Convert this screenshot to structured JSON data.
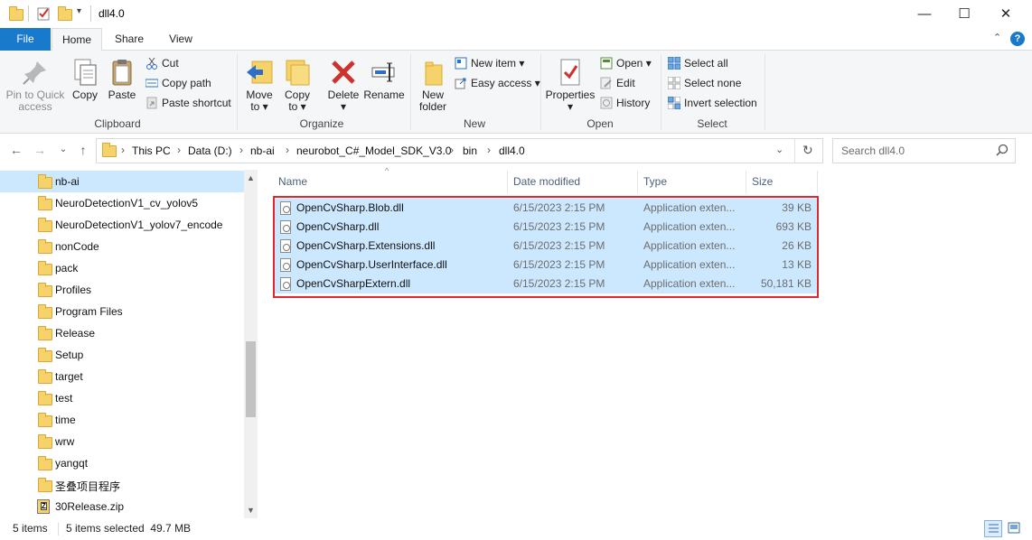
{
  "title": "dll4.0",
  "window_buttons": {
    "minimize": "—",
    "maximize": "☐",
    "close": "✕"
  },
  "tabs": {
    "file": "File",
    "home": "Home",
    "share": "Share",
    "view": "View"
  },
  "ribbon": {
    "clipboard": {
      "label": "Clipboard",
      "pin": "Pin to Quick access",
      "pin_line1": "Pin to Quick",
      "pin_line2": "access",
      "copy": "Copy",
      "paste": "Paste",
      "cut": "Cut",
      "copy_path": "Copy path",
      "paste_shortcut": "Paste shortcut"
    },
    "organize": {
      "label": "Organize",
      "move_to_1": "Move",
      "move_to_2": "to ▾",
      "copy_to_1": "Copy",
      "copy_to_2": "to ▾",
      "delete_1": "Delete",
      "delete_2": "▾",
      "rename": "Rename"
    },
    "new": {
      "label": "New",
      "new_folder_1": "New",
      "new_folder_2": "folder",
      "new_item": "New item ▾",
      "easy_access": "Easy access ▾"
    },
    "open": {
      "label": "Open",
      "properties": "Properties",
      "properties_arrow": "▾",
      "open": "Open ▾",
      "edit": "Edit",
      "history": "History"
    },
    "select": {
      "label": "Select",
      "select_all": "Select all",
      "select_none": "Select none",
      "invert": "Invert selection"
    }
  },
  "address": {
    "crumbs": [
      "This PC",
      "Data (D:)",
      "nb-ai",
      "neurobot_C#_Model_SDK_V3.0",
      "bin",
      "dll4.0"
    ],
    "search_placeholder": "Search dll4.0"
  },
  "nav": {
    "items": [
      {
        "label": "nb-ai",
        "selected": true
      },
      {
        "label": "NeuroDetectionV1_cv_yolov5"
      },
      {
        "label": "NeuroDetectionV1_yolov7_encode"
      },
      {
        "label": "nonCode"
      },
      {
        "label": "pack"
      },
      {
        "label": "Profiles"
      },
      {
        "label": "Program Files"
      },
      {
        "label": "Release"
      },
      {
        "label": "Setup"
      },
      {
        "label": "target"
      },
      {
        "label": "test"
      },
      {
        "label": "time"
      },
      {
        "label": "wrw"
      },
      {
        "label": "yangqt"
      },
      {
        "label": "圣叠项目程序"
      },
      {
        "label": "30Release.zip"
      }
    ]
  },
  "columns": {
    "name": "Name",
    "date": "Date modified",
    "type": "Type",
    "size": "Size"
  },
  "files": [
    {
      "name": "OpenCvSharp.Blob.dll",
      "date": "6/15/2023 2:15 PM",
      "type": "Application exten...",
      "size": "39 KB"
    },
    {
      "name": "OpenCvSharp.dll",
      "date": "6/15/2023 2:15 PM",
      "type": "Application exten...",
      "size": "693 KB"
    },
    {
      "name": "OpenCvSharp.Extensions.dll",
      "date": "6/15/2023 2:15 PM",
      "type": "Application exten...",
      "size": "26 KB"
    },
    {
      "name": "OpenCvSharp.UserInterface.dll",
      "date": "6/15/2023 2:15 PM",
      "type": "Application exten...",
      "size": "13 KB"
    },
    {
      "name": "OpenCvSharpExtern.dll",
      "date": "6/15/2023 2:15 PM",
      "type": "Application exten...",
      "size": "50,181 KB"
    }
  ],
  "status": {
    "count": "5 items",
    "selected": "5 items selected  49.7 MB"
  },
  "colors": {
    "accent": "#1979ca",
    "selection": "#cce8ff",
    "highlight_border": "#e0282e"
  }
}
